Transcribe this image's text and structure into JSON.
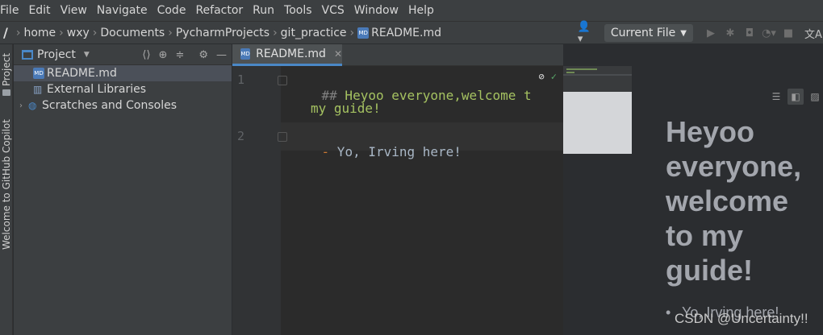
{
  "menu": [
    "File",
    "Edit",
    "View",
    "Navigate",
    "Code",
    "Refactor",
    "Run",
    "Tools",
    "VCS",
    "Window",
    "Help"
  ],
  "breadcrumb": [
    "home",
    "wxy",
    "Documents",
    "PycharmProjects",
    "git_practice",
    "README.md"
  ],
  "run_config": {
    "label": "Current File"
  },
  "left_stripe": {
    "project_tab": "Project",
    "copilot_tab": "Welcome to GitHub Copilot"
  },
  "project_panel": {
    "title": "Project",
    "tree": [
      {
        "label": "README.md",
        "icon": "markdown-file-icon",
        "selected": true
      },
      {
        "label": "External Libraries",
        "icon": "libraries-icon",
        "selected": false
      },
      {
        "label": "Scratches and Consoles",
        "icon": "scratches-icon",
        "selected": false
      }
    ]
  },
  "editor": {
    "tab_label": "README.md",
    "md_badge": "MD",
    "lines": [
      {
        "num": "1",
        "marker": "##",
        "text": " Heyoo everyone,welcome t",
        "wrap": "my guide!"
      },
      {
        "num": "2",
        "marker": "-",
        "text": " Yo, Irving here!"
      }
    ]
  },
  "preview": {
    "heading": "Heyoo everyone, welcome to my guide!",
    "list_item": "Yo, Irving here!"
  },
  "watermark": "CSDN @Uncertainty!!",
  "colors": {
    "accent": "#4a88c7",
    "heading": "#a5c261",
    "bullet": "#cc7832",
    "check": "#59a869"
  }
}
